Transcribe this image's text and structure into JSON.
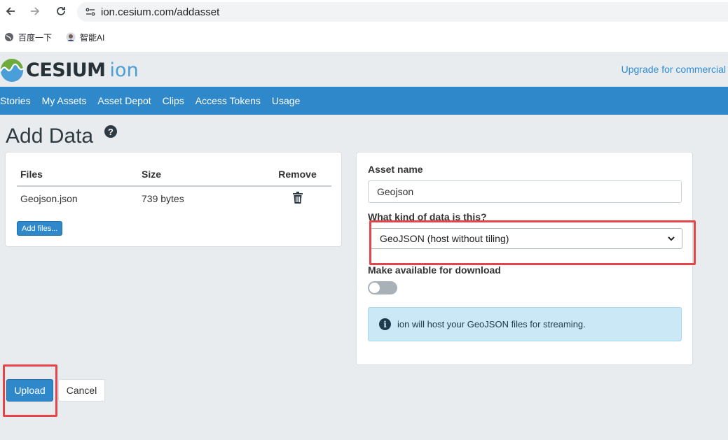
{
  "browser": {
    "url": "ion.cesium.com/addasset",
    "bookmarks": [
      {
        "label": "百度一下",
        "icon": "globe-icon"
      },
      {
        "label": "智能AI",
        "icon": "avatar-icon"
      }
    ]
  },
  "header": {
    "logo_text": "CESIUM",
    "logo_suffix": "ion",
    "upgrade_link": "Upgrade for commercial"
  },
  "nav": {
    "items": [
      "Stories",
      "My Assets",
      "Asset Depot",
      "Clips",
      "Access Tokens",
      "Usage"
    ]
  },
  "page": {
    "title": "Add Data",
    "help_icon": "?"
  },
  "files": {
    "headers": {
      "files": "Files",
      "size": "Size",
      "remove": "Remove"
    },
    "rows": [
      {
        "name": "Geojson.json",
        "size": "739 bytes"
      }
    ],
    "add_button": "Add files..."
  },
  "asset": {
    "name_label": "Asset name",
    "name_value": "Geojson",
    "kind_label": "What kind of data is this?",
    "kind_value": "GeoJSON (host without tiling)",
    "download_label": "Make available for download",
    "download_enabled": false,
    "info_text": "ion will host your GeoJSON files for streaming."
  },
  "actions": {
    "upload": "Upload",
    "cancel": "Cancel"
  },
  "colors": {
    "accent": "#2e88c9",
    "highlight": "#e5454a",
    "background": "#e8ecef"
  }
}
